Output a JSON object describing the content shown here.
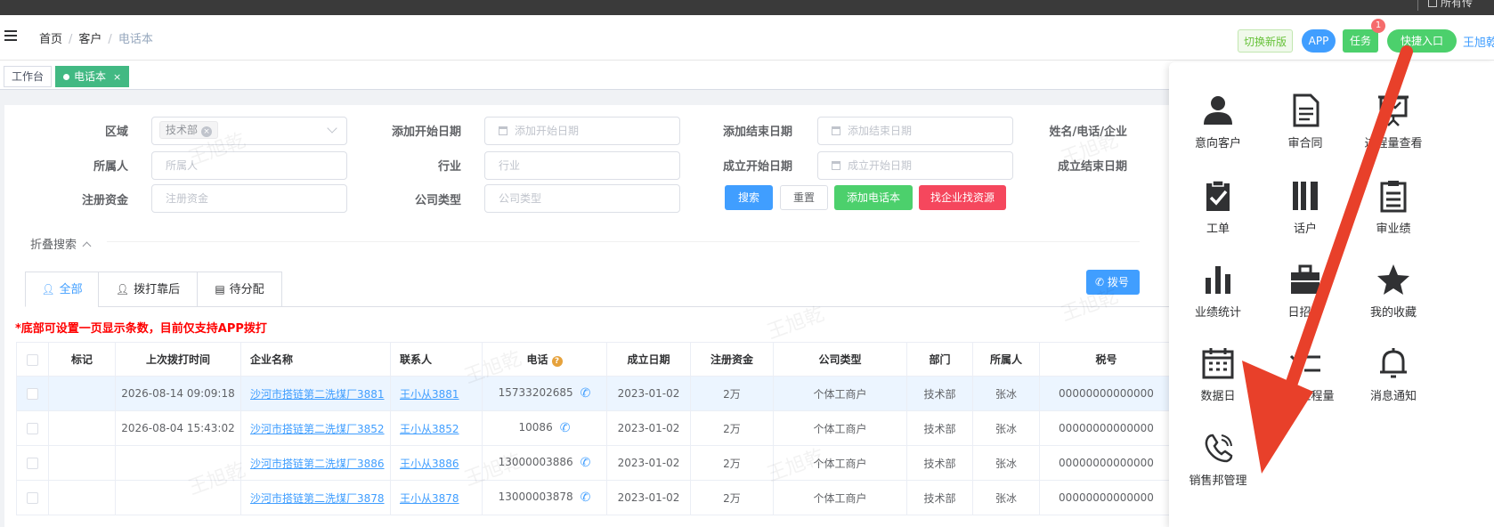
{
  "topbar": {
    "partial_text": "所有传"
  },
  "navbar": {
    "breadcrumb": [
      "首页",
      "客户",
      "电话本"
    ],
    "btn_newver": "切换新版",
    "btn_app": "APP",
    "btn_task": "任务",
    "task_badge": "1",
    "btn_quick": "快捷入口",
    "username": "王旭乾"
  },
  "tags": {
    "workbench": "工作台",
    "phonebook": "电话本",
    "close": "×"
  },
  "filters": {
    "region_label": "区域",
    "region_chip": "技术部",
    "add_start_label": "添加开始日期",
    "add_start_ph": "添加开始日期",
    "add_end_label": "添加结束日期",
    "add_end_ph": "添加结束日期",
    "name_label": "姓名/电话/企业",
    "owner_label": "所属人",
    "owner_ph": "所属人",
    "industry_label": "行业",
    "industry_ph": "行业",
    "found_start_label": "成立开始日期",
    "found_start_ph": "成立开始日期",
    "found_end_label": "成立结束日期",
    "capital_label": "注册资金",
    "capital_ph": "注册资金",
    "ctype_label": "公司类型",
    "ctype_ph": "公司类型",
    "btn_search": "搜索",
    "btn_reset": "重置",
    "btn_add": "添加电话本",
    "btn_find": "找企业找资源",
    "fold": "折叠搜索"
  },
  "tabs": [
    "全部",
    "拨打靠后",
    "待分配"
  ],
  "dial_btn": "拨号",
  "notice": "*底部可设置一页显示条数，目前仅支持APP拨打",
  "table": {
    "headers": [
      "标记",
      "上次拨打时间",
      "企业名称",
      "联系人",
      "电话",
      "成立日期",
      "注册资金",
      "公司类型",
      "部门",
      "所属人",
      "税号"
    ],
    "rows": [
      {
        "mark": "",
        "last_call": "2026-08-14 09:09:18",
        "company": "沙河市搭链第二洗煤厂3881",
        "contact": "王小从3881",
        "phone": "15733202685",
        "date": "2023-01-02",
        "capital": "2万",
        "type": "个体工商户",
        "dept": "技术部",
        "owner": "张冰",
        "tax": "00000000000000"
      },
      {
        "mark": "",
        "last_call": "2026-08-04 15:43:02",
        "company": "沙河市搭链第二洗煤厂3852",
        "contact": "王小从3852",
        "phone": "10086",
        "date": "2023-01-02",
        "capital": "2万",
        "type": "个体工商户",
        "dept": "技术部",
        "owner": "张冰",
        "tax": "00000000000000"
      },
      {
        "mark": "",
        "last_call": "",
        "company": "沙河市搭链第二洗煤厂3886",
        "contact": "王小从3886",
        "phone": "13000003886",
        "date": "2023-01-02",
        "capital": "2万",
        "type": "个体工商户",
        "dept": "技术部",
        "owner": "张冰",
        "tax": "00000000000000"
      },
      {
        "mark": "",
        "last_call": "",
        "company": "沙河市搭链第二洗煤厂3878",
        "contact": "王小从3878",
        "phone": "13000003878",
        "date": "2023-01-02",
        "capital": "2万",
        "type": "个体工商户",
        "dept": "技术部",
        "owner": "张冰",
        "tax": "00000000000000"
      }
    ]
  },
  "watermark": "王旭乾",
  "quick": [
    {
      "label": "意向客户",
      "icon": "person-icon"
    },
    {
      "label": "审合同",
      "icon": "document-icon"
    },
    {
      "label": "过程量查看",
      "icon": "presentation-icon"
    },
    {
      "label": "工单",
      "icon": "clipboard-check-icon"
    },
    {
      "label": "话户",
      "icon": "bars-icon"
    },
    {
      "label": "审业绩",
      "icon": "clipboard-list-icon"
    },
    {
      "label": "业绩统计",
      "icon": "bar-chart-icon"
    },
    {
      "label": "日招聘",
      "icon": "briefcase-icon"
    },
    {
      "label": "我的收藏",
      "icon": "star-icon"
    },
    {
      "label": "数据日",
      "icon": "calendar-icon"
    },
    {
      "label": "录入过程量",
      "icon": "checklist-icon"
    },
    {
      "label": "消息通知",
      "icon": "bell-icon"
    },
    {
      "label": "销售邦管理",
      "icon": "phone-icon"
    }
  ],
  "colors": {
    "primary": "#409eff",
    "success": "#4cd06c",
    "danger": "#f5475d",
    "arrow": "#e8402a"
  }
}
